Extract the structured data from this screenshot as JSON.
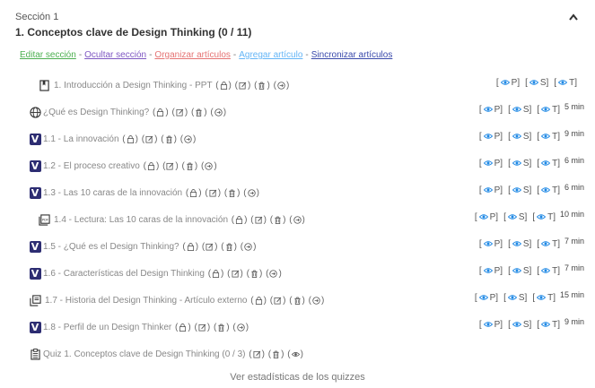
{
  "section": {
    "label": "Sección 1",
    "title": "1. Conceptos clave de Design Thinking (0 / 11)"
  },
  "actions": [
    {
      "label": "Editar sección",
      "color": "#4caf50"
    },
    {
      "label": "Ocultar sección",
      "color": "#7e57c2"
    },
    {
      "label": "Organizar artículos",
      "color": "#e57373"
    },
    {
      "label": "Agregar artículo",
      "color": "#64b5f6"
    },
    {
      "label": "Sincronizar artículos",
      "color": "#3949ab"
    }
  ],
  "separator": "-",
  "paren_open": "(",
  "paren_close": ")",
  "visibility_labels": [
    "P",
    "S",
    "T"
  ],
  "bracket_open": "[",
  "bracket_close": "]",
  "items": [
    {
      "icon": "bookmark-icon",
      "title": "1. Introducción a Design Thinking - PPT",
      "duration": ""
    },
    {
      "icon": "globe-icon",
      "title": "¿Qué es Design Thinking?",
      "duration": "5 min"
    },
    {
      "icon": "vimeo-icon",
      "title": "1.1 - La innovación",
      "duration": "9 min"
    },
    {
      "icon": "vimeo-icon",
      "title": "1.2 - El proceso creativo",
      "duration": "6 min"
    },
    {
      "icon": "vimeo-icon",
      "title": "1.3 - Las 10 caras de la innovación",
      "duration": "6 min"
    },
    {
      "icon": "pdf-icon",
      "title": "1.4 - Lectura: Las 10 caras de la innovación",
      "duration": "10 min"
    },
    {
      "icon": "vimeo-icon",
      "title": "1.5 - ¿Qué es el Design Thinking?",
      "duration": "7 min"
    },
    {
      "icon": "vimeo-icon",
      "title": "1.6 - Características del Design Thinking",
      "duration": "7 min"
    },
    {
      "icon": "stack-icon",
      "title": "1.7 - Historia del Design Thinking - Artículo externo",
      "duration": "15 min"
    },
    {
      "icon": "vimeo-icon",
      "title": "1.8 - Perfil de un Design Thinker",
      "duration": "9 min"
    }
  ],
  "quiz": {
    "icon": "clipboard-icon",
    "title": "Quiz 1. Conceptos clave de Design Thinking (0 / 3)"
  },
  "vimeo_glyph": "V",
  "footer_link": "Ver estadísticas de los quizzes"
}
